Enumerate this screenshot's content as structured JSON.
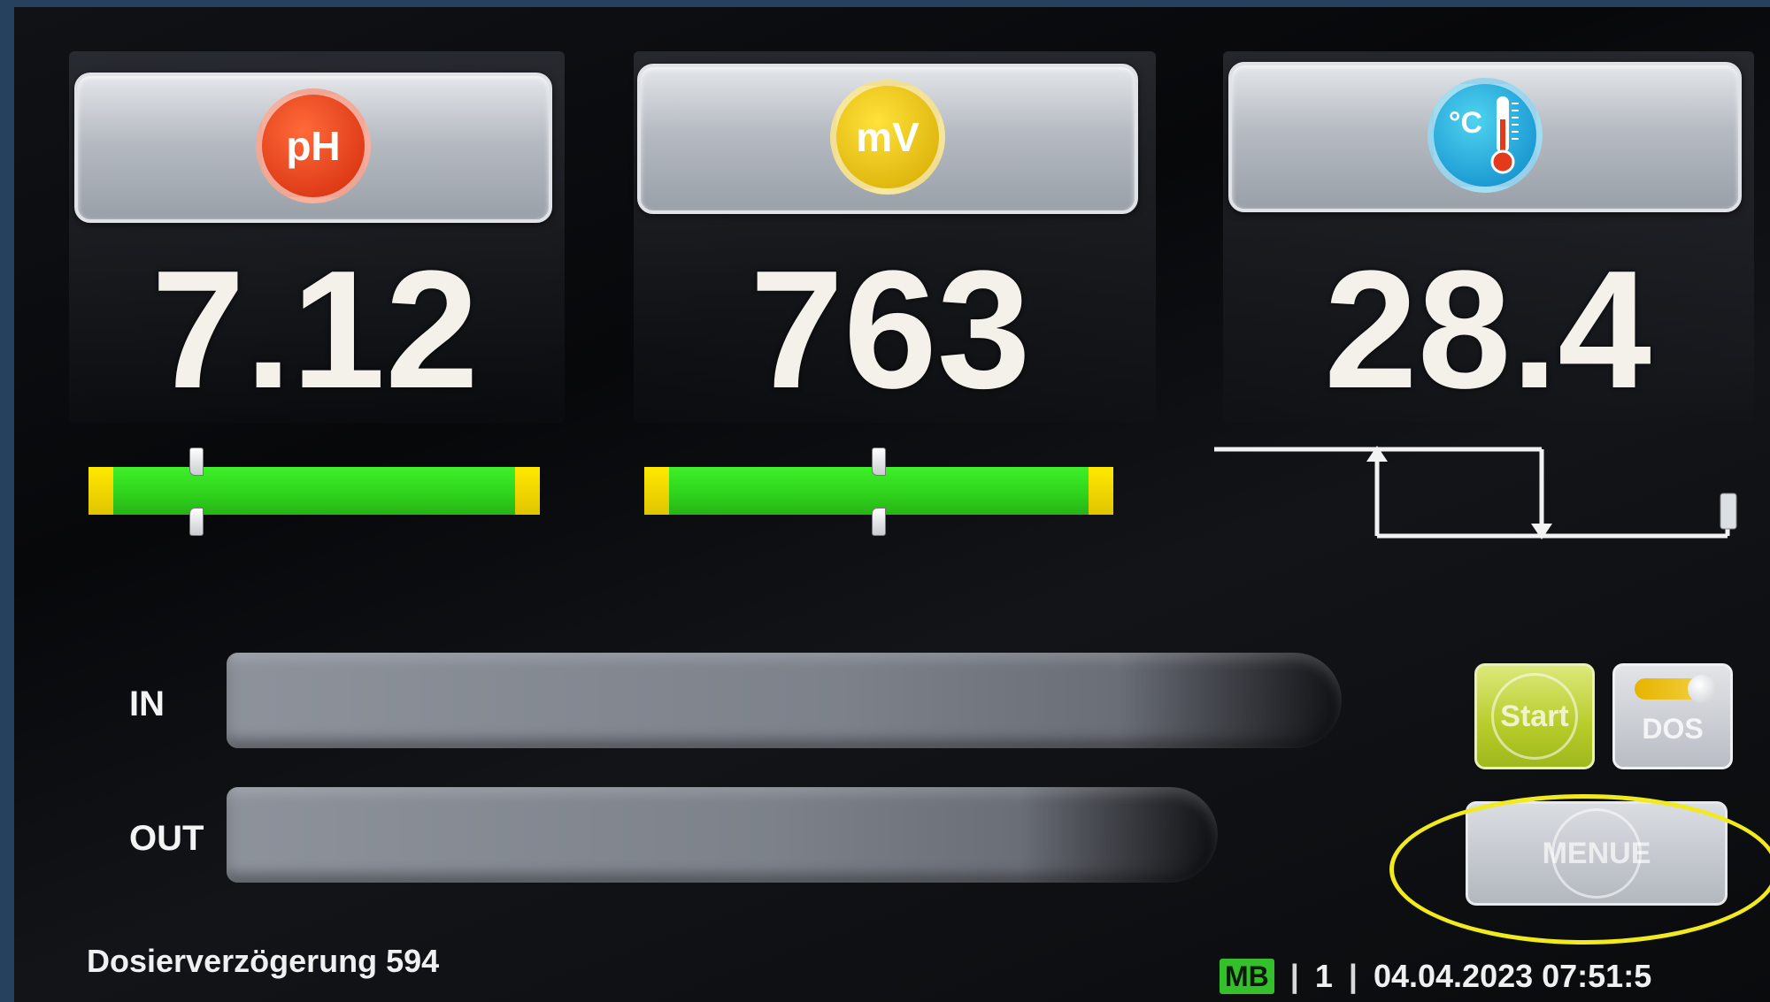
{
  "sensors": [
    {
      "badge": "pH",
      "value": "7.12",
      "icon": "ph-badge-icon",
      "color": "#d22a0a"
    },
    {
      "badge": "mV",
      "value": "763",
      "icon": "mv-badge-icon",
      "color": "#d4a800"
    },
    {
      "badge": "°C",
      "value": "28.4",
      "icon": "thermometer-icon",
      "color": "#0a86c8"
    }
  ],
  "scale_markers": {
    "ph_fraction": 0.24,
    "mv_fraction": 0.5
  },
  "io": {
    "in_label": "IN",
    "out_label": "OUT"
  },
  "buttons": {
    "start_label": "Start",
    "dos_label": "DOS",
    "menu_label": "MENUE"
  },
  "status": {
    "message": "Dosierverzögerung 594",
    "mode_badge": "MB",
    "separator": "|",
    "channel": "1",
    "datetime": "04.04.2023 07:51:5"
  },
  "colors": {
    "scale_green": "#3ef02a",
    "scale_limit": "#ffe900",
    "annotation": "#f1ea1c"
  }
}
